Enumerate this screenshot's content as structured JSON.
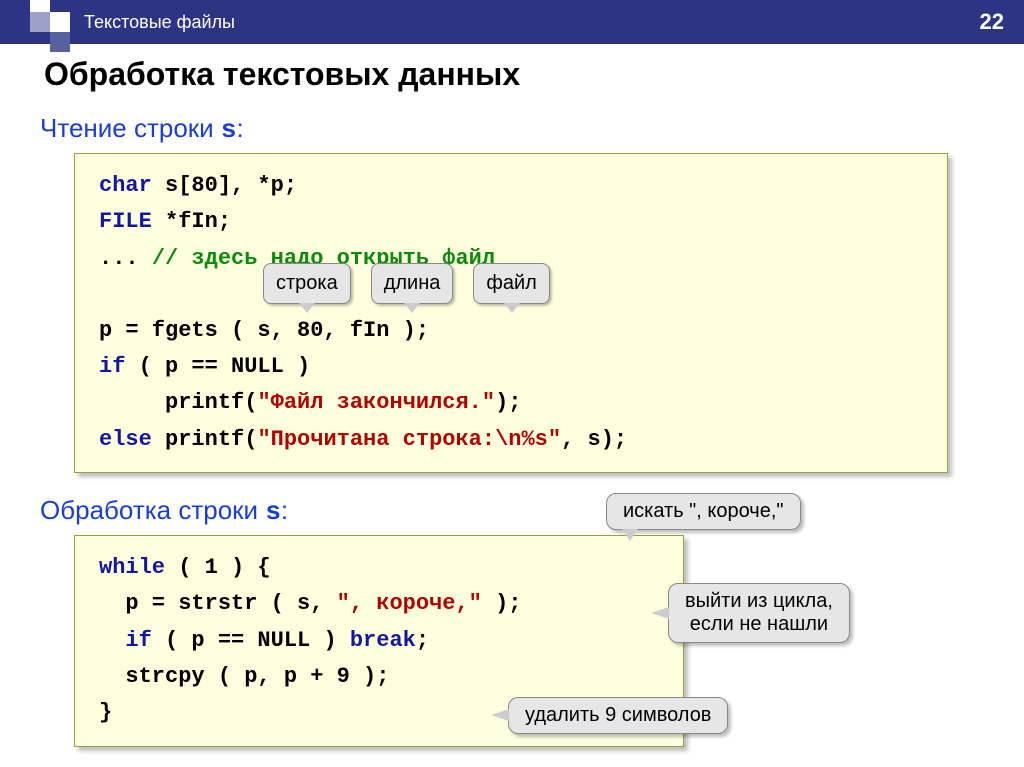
{
  "header": {
    "title": "Текстовые файлы",
    "page": "22"
  },
  "title": "Обработка текстовых данных",
  "section1": {
    "heading_prefix": "Чтение строки ",
    "heading_var": "s",
    "heading_suffix": ":"
  },
  "code1": {
    "l1a": "char",
    "l1b": " s[80], *p;",
    "l2a": "FILE",
    "l2b": " *fIn;",
    "l3a": "... ",
    "l3b": "// здесь надо открыть файл",
    "l4": "p = fgets ( s, 80, fIn );",
    "l5a": "if",
    "l5b": " ( p == NULL )",
    "l6a": "     printf(",
    "l6b": "\"Файл закончился.\"",
    "l6c": ");",
    "l7a": "else",
    "l7b": " printf(",
    "l7c": "\"Прочитана строка:\\n%s\"",
    "l7d": ", s);"
  },
  "labels1": {
    "a": "строка",
    "b": "длина",
    "c": "файл"
  },
  "section2": {
    "heading_prefix": "Обработка строки ",
    "heading_var": "s",
    "heading_suffix": ":"
  },
  "code2": {
    "l1a": "while",
    "l1b": " ( 1 ) {",
    "l2a": "  p = strstr ( s, ",
    "l2b": "\", короче,\"",
    "l2c": " );",
    "l3a": "  if",
    "l3b": " ( p == NULL ) ",
    "l3c": "break",
    "l3d": ";",
    "l4": "  strcpy ( p, p + 9 );",
    "l5": "}"
  },
  "callouts2": {
    "a": "искать \", короче,\"",
    "b1": "выйти из цикла,",
    "b2": "если не нашли",
    "c": "удалить 9 символов"
  }
}
